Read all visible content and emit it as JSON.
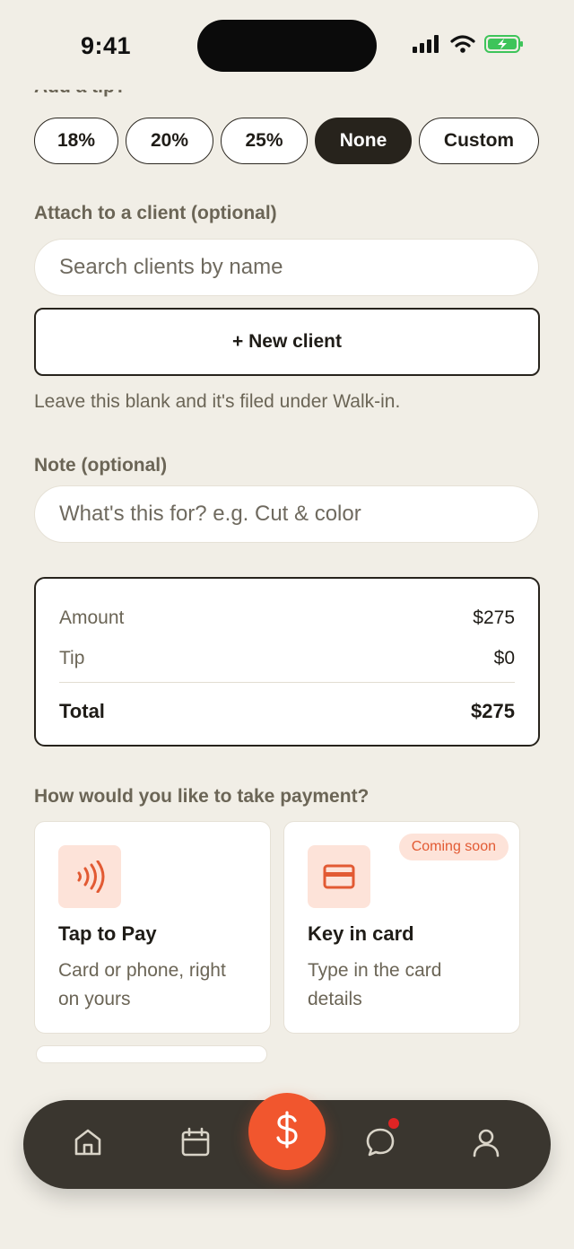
{
  "status": {
    "time": "9:41"
  },
  "tip": {
    "label": "Add a tip?",
    "options": [
      "18%",
      "20%",
      "25%",
      "None",
      "Custom"
    ],
    "selected": "None"
  },
  "client": {
    "label": "Attach to a client (optional)",
    "search_placeholder": "Search clients by name",
    "new_button": "+ New client",
    "hint": "Leave this blank and it's filed under Walk-in."
  },
  "note": {
    "label": "Note (optional)",
    "placeholder": "What's this for? e.g. Cut & color"
  },
  "summary": {
    "amount_label": "Amount",
    "amount": "$275",
    "tip_label": "Tip",
    "tip": "$0",
    "total_label": "Total",
    "total": "$275"
  },
  "payment": {
    "label": "How would you like to take payment?",
    "methods": [
      {
        "title": "Tap to Pay",
        "desc": "Card or phone, right on yours",
        "icon": "contactless-icon"
      },
      {
        "title": "Key in card",
        "desc": "Type in the card details",
        "icon": "card-icon",
        "badge": "Coming soon"
      }
    ]
  },
  "tabbar": {
    "items": [
      "home-icon",
      "calendar-icon",
      "dollar-icon",
      "chat-icon",
      "profile-icon"
    ],
    "notification_dot": true
  },
  "colors": {
    "accent": "#f1562e",
    "dark": "#27231c",
    "background": "#f1eee6",
    "muted": "#6b6556"
  }
}
